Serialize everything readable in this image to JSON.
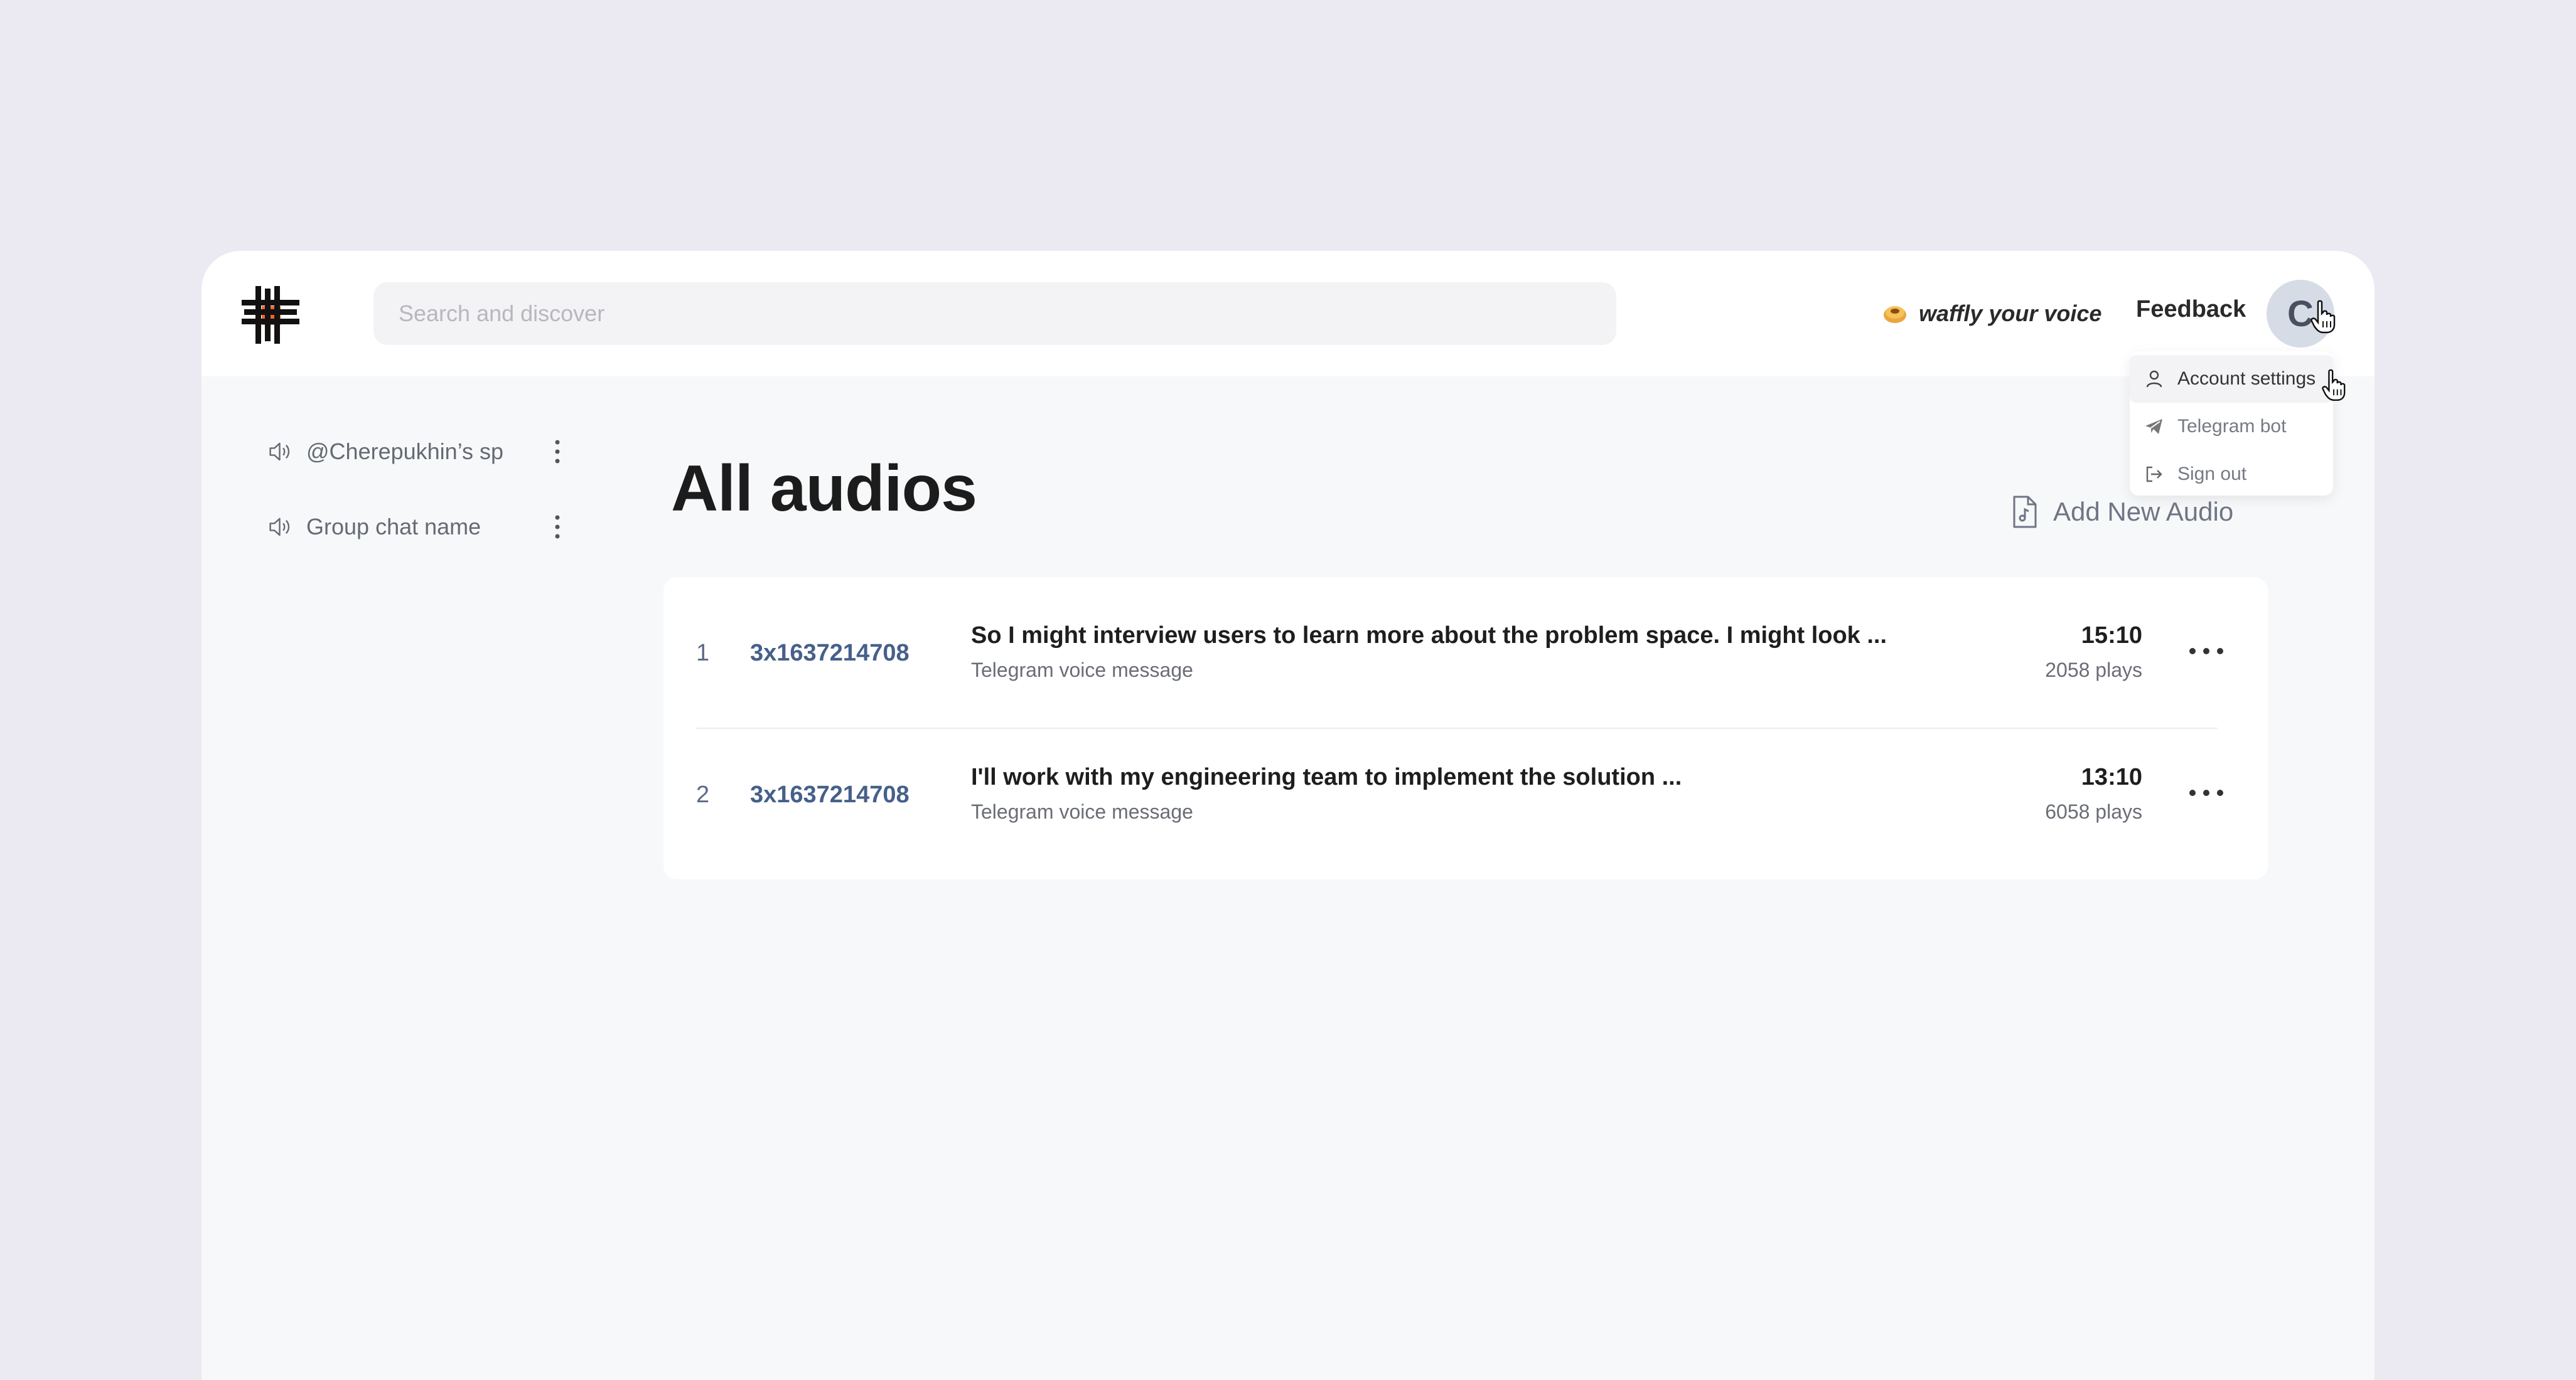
{
  "search": {
    "placeholder": "Search and discover"
  },
  "header": {
    "promo_label": "waffly your voice",
    "feedback_label": "Feedback",
    "avatar_initial": "C"
  },
  "account_menu": {
    "items": [
      {
        "label": "Account settings",
        "icon": "user-icon"
      },
      {
        "label": "Telegram bot",
        "icon": "telegram-icon"
      },
      {
        "label": "Sign out",
        "icon": "sign-out-icon"
      }
    ]
  },
  "sidebar": {
    "items": [
      {
        "label": "@Cherepukhin’s sp..",
        "icon": "speaker-icon"
      },
      {
        "label": "Group chat name",
        "icon": "speaker-icon"
      }
    ]
  },
  "main": {
    "title": "All audios",
    "add_audio_label": "Add New Audio",
    "audios": [
      {
        "index": "1",
        "id": "3x1637214708",
        "title": "So I might interview users to learn more about the problem space. I might look ...",
        "source": "Telegram voice message",
        "duration": "15:10",
        "plays": "2058 plays"
      },
      {
        "index": "2",
        "id": "3x1637214708",
        "title": "I'll work with my engineering team to implement the solution ...",
        "source": "Telegram voice message",
        "duration": "13:10",
        "plays": "6058 plays"
      }
    ]
  },
  "colors": {
    "background": "#ebeaf2",
    "surface": "#f7f8fa",
    "accent_link": "#46608a",
    "logo_accent": "#f0642a"
  }
}
